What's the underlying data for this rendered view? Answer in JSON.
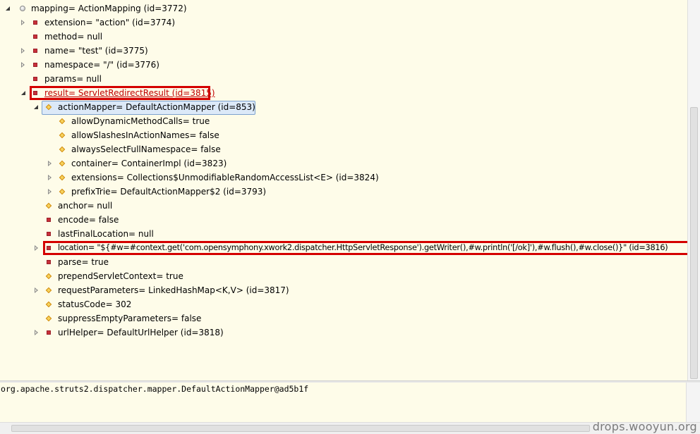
{
  "tree": {
    "rows": [
      {
        "label": "mapping= ActionMapping  (id=3772)"
      },
      {
        "label": "extension= \"action\" (id=3774)"
      },
      {
        "label": "method= null"
      },
      {
        "label": "name= \"test\" (id=3775)"
      },
      {
        "label": "namespace= \"/\" (id=3776)"
      },
      {
        "label": "params= null"
      },
      {
        "label": "result= ServletRedirectResult  (id=3815)"
      },
      {
        "label": "actionMapper= DefaultActionMapper  (id=853)"
      },
      {
        "label": "allowDynamicMethodCalls= true"
      },
      {
        "label": "allowSlashesInActionNames= false"
      },
      {
        "label": "alwaysSelectFullNamespace= false"
      },
      {
        "label": "container= ContainerImpl  (id=3823)"
      },
      {
        "label": "extensions= Collections$UnmodifiableRandomAccessList<E>  (id=3824)"
      },
      {
        "label": "prefixTrie= DefaultActionMapper$2  (id=3793)"
      },
      {
        "label": "anchor= null"
      },
      {
        "label": "encode= false"
      },
      {
        "label": "lastFinalLocation= null"
      },
      {
        "label": "location= \"${#w=#context.get('com.opensymphony.xwork2.dispatcher.HttpServletResponse').getWriter(),#w.println('[/ok]'),#w.flush(),#w.close()}\" (id=3816)"
      },
      {
        "label": "parse= true"
      },
      {
        "label": "prependServletContext= true"
      },
      {
        "label": "requestParameters= LinkedHashMap<K,V>  (id=3817)"
      },
      {
        "label": "statusCode= 302"
      },
      {
        "label": "suppressEmptyParameters= false"
      },
      {
        "label": "urlHelper= DefaultUrlHelper  (id=3818)"
      }
    ]
  },
  "detail": {
    "text": "org.apache.struts2.dispatcher.mapper.DefaultActionMapper@ad5b1f"
  },
  "watermark": "drops.wooyun.org",
  "icons": {
    "expand_closed": "tree-expand-closed-icon",
    "expand_open": "tree-expand-open-icon",
    "field_private": "private-field-icon",
    "field_protected": "protected-field-icon",
    "local_variable": "local-variable-icon"
  },
  "colors": {
    "tree_background": "#fefce9",
    "highlight_box": "#d40000",
    "selection": "#dce9f8",
    "red_label": "#c00000"
  }
}
